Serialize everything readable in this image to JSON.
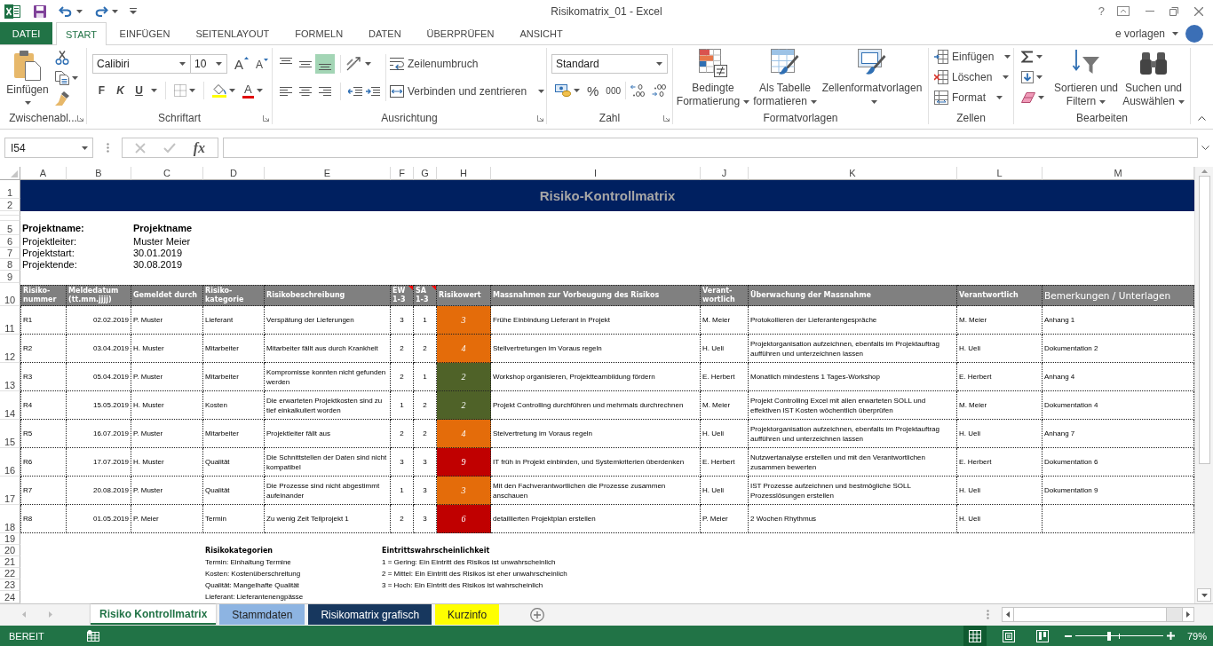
{
  "window": {
    "title": "Risikomatrix_01 - Excel",
    "help": "?"
  },
  "ribbon_tabs": [
    {
      "label": "DATEI",
      "kind": "file",
      "selected": false
    },
    {
      "label": "START",
      "kind": "tab",
      "selected": true
    },
    {
      "label": "EINFÜGEN",
      "kind": "tab",
      "selected": false
    },
    {
      "label": "SEITENLAYOUT",
      "kind": "tab",
      "selected": false
    },
    {
      "label": "FORMELN",
      "kind": "tab",
      "selected": false
    },
    {
      "label": "DATEN",
      "kind": "tab",
      "selected": false
    },
    {
      "label": "ÜBERPRÜFEN",
      "kind": "tab",
      "selected": false
    },
    {
      "label": "ANSICHT",
      "kind": "tab",
      "selected": false
    }
  ],
  "account": {
    "name": "e vorlagen"
  },
  "ribbon": {
    "clipboard": {
      "label": "Zwischenabl...",
      "paste": "Einfügen"
    },
    "font": {
      "label": "Schriftart",
      "font_name": "Calibiri",
      "font_size": "10",
      "grow": "A",
      "shrink": "A",
      "styles": [
        {
          "label": "F",
          "kind": "bold"
        },
        {
          "label": "K",
          "kind": "italic"
        },
        {
          "label": "U",
          "kind": "underline"
        }
      ],
      "font_color": "A"
    },
    "alignment": {
      "label": "Ausrichtung",
      "vertical": [
        {
          "kind": "top",
          "selected": false
        },
        {
          "kind": "middle",
          "selected": false
        },
        {
          "kind": "bottom",
          "selected": true
        }
      ],
      "wrap": "Zeilenumbruch",
      "merge": "Verbinden und zentrieren"
    },
    "number": {
      "label": "Zahl",
      "format": "Standard",
      "percent": "%",
      "thousands": "000"
    },
    "styles": {
      "label": "Formatvorlagen",
      "buttons": [
        {
          "label": "Bedingte Formatierung",
          "kind": "conditional"
        },
        {
          "label": "Als Tabelle formatieren",
          "kind": "table"
        },
        {
          "label": "Zellenformatvorlagen",
          "kind": "cell_styles"
        }
      ]
    },
    "cells": {
      "label": "Zellen",
      "buttons": [
        {
          "label": "Einfügen",
          "kind": "insert"
        },
        {
          "label": "Löschen",
          "kind": "delete"
        },
        {
          "label": "Format",
          "kind": "format"
        }
      ]
    },
    "editing": {
      "label": "Bearbeiten",
      "buttons": [
        {
          "label": "Sortieren und Filtern",
          "kind": "sort"
        },
        {
          "label": "Suchen und Auswählen",
          "kind": "find"
        }
      ]
    }
  },
  "formula_bar": {
    "name_box": "I54",
    "function_label": "fx"
  },
  "sheet": {
    "column_headers": [
      "A",
      "B",
      "C",
      "D",
      "E",
      "F",
      "G",
      "H",
      "I",
      "J",
      "K",
      "L",
      "M"
    ],
    "row_numbers": [
      "1",
      "2",
      "5",
      "6",
      "7",
      "8",
      "9",
      "10",
      "11",
      "12",
      "13",
      "14",
      "15",
      "16",
      "17",
      "18",
      "19",
      "20",
      "21",
      "22",
      "23",
      "24"
    ],
    "title": "Risiko-Kontrollmatrix",
    "project": [
      {
        "label": "Projektname:",
        "value": "Projektname",
        "bold": true
      },
      {
        "label": "Projektleiter:",
        "value": "Muster Meier",
        "bold": false
      },
      {
        "label": "Projektstart:",
        "value": "30.01.2019",
        "bold": false
      },
      {
        "label": "Projektende:",
        "value": "30.08.2019",
        "bold": false
      }
    ],
    "table": {
      "columns": [
        {
          "label": "Risiko-nummer",
          "comment": false
        },
        {
          "label": "Meldedatum (tt.mm.jjjj)",
          "comment": false
        },
        {
          "label": "Gemeldet durch",
          "comment": false
        },
        {
          "label": "Risiko-kategorie",
          "comment": false
        },
        {
          "label": "Risikobeschreibung",
          "comment": false
        },
        {
          "label": "EW 1-3",
          "comment": true
        },
        {
          "label": "SA 1-3",
          "comment": true
        },
        {
          "label": "Risikowert",
          "comment": false
        },
        {
          "label": "Massnahmen zur Vorbeugung des Risikos",
          "comment": false
        },
        {
          "label": "Verant-wortlich",
          "comment": false
        },
        {
          "label": "Überwachung der Massnahme",
          "comment": false
        },
        {
          "label": "Verantwortlich",
          "comment": false
        },
        {
          "label": "Bemerkungen / Unterlagen",
          "comment": false
        }
      ],
      "rows": [
        {
          "id": "R1",
          "date": "02.02.2019",
          "reported_by": "P. Muster",
          "category": "Lieferant",
          "description": "Verspätung der Lieferungen",
          "ew": "3",
          "sa": "1",
          "risk_value": "3",
          "color": "#e46c0a",
          "measure": "Frühe Einbindung Lieferant in Projekt",
          "responsible": "M. Meier",
          "monitoring": "Protokollieren der Lieferantengespräche",
          "monitoring_responsible": "M. Meier",
          "notes": "Anhang 1"
        },
        {
          "id": "R2",
          "date": "03.04.2019",
          "reported_by": "H. Muster",
          "category": "Mitarbeiter",
          "description": "Mitarbeiter fällt aus durch Krankheit",
          "ew": "2",
          "sa": "2",
          "risk_value": "4",
          "color": "#e46c0a",
          "measure": "Stellvertretungen im Voraus regeln",
          "responsible": "H. Ueli",
          "monitoring": "Projektorganisation aufzeichnen, ebenfalls im Projektauftrag aufführen und unterzeichnen lassen",
          "monitoring_responsible": "H. Ueli",
          "notes": "Dokumentation 2"
        },
        {
          "id": "R3",
          "date": "05.04.2019",
          "reported_by": "P. Muster",
          "category": "Mitarbeiter",
          "description": "Kompromisse konnten nicht gefunden werden",
          "ew": "2",
          "sa": "1",
          "risk_value": "2",
          "color": "#4f6228",
          "measure": "Workshop organisieren, Projektteambildung fördern",
          "responsible": "E. Herbert",
          "monitoring": "Monatlich mindestens 1 Tages-Workshop",
          "monitoring_responsible": "E. Herbert",
          "notes": "Anhang 4"
        },
        {
          "id": "R4",
          "date": "15.05.2019",
          "reported_by": "H. Muster",
          "category": "Kosten",
          "description": "Die erwarteten Projektkosten sind zu tief einkalkuliert worden",
          "ew": "1",
          "sa": "2",
          "risk_value": "2",
          "color": "#4f6228",
          "measure": "Projekt Controlling durchführen und mehrmals durchrechnen",
          "responsible": "M. Meier",
          "monitoring": "Projekt Controlling Excel mit allen erwarteten SOLL und effektiven IST Kosten wöchentlich überprüfen",
          "monitoring_responsible": "M. Meier",
          "notes": "Dokumentation 4"
        },
        {
          "id": "R5",
          "date": "16.07.2019",
          "reported_by": "P. Muster",
          "category": "Mitarbeiter",
          "description": "Projektleiter fällt aus",
          "ew": "2",
          "sa": "2",
          "risk_value": "4",
          "color": "#e46c0a",
          "measure": "Stelvertretung im Voraus regeln",
          "responsible": "H. Ueli",
          "monitoring": "Projektorganisation aufzeichnen, ebenfalls im Projektauftrag aufführen und unterzeichnen lassen",
          "monitoring_responsible": "H. Ueli",
          "notes": "Anhang 7"
        },
        {
          "id": "R6",
          "date": "17.07.2019",
          "reported_by": "H. Muster",
          "category": "Qualität",
          "description": "Die Schnittstellen der Daten sind nicht kompatibel",
          "ew": "3",
          "sa": "3",
          "risk_value": "9",
          "color": "#c00000",
          "measure": "IT früh in Projekt einbinden, und Systemkriterien überdenken",
          "responsible": "E. Herbert",
          "monitoring": "Nutzwertanalyse erstellen und mit den Verantwortlichen zusammen bewerten",
          "monitoring_responsible": "E. Herbert",
          "notes": "Dokumentation 6"
        },
        {
          "id": "R7",
          "date": "20.08.2019",
          "reported_by": "P. Muster",
          "category": "Qualität",
          "description": "Die Prozesse sind nicht abgestimmt aufeinander",
          "ew": "1",
          "sa": "3",
          "risk_value": "3",
          "color": "#e46c0a",
          "measure": "Mit den Fachverantwortlichen die Prozesse zusammen anschauen",
          "responsible": "H. Ueli",
          "monitoring": "IST Prozesse aufzeichnen und bestmögliche SOLL Prozesslösungen erstellen",
          "monitoring_responsible": "H. Ueli",
          "notes": "Dokumentation 9"
        },
        {
          "id": "R8",
          "date": "01.05.2019",
          "reported_by": "P. Meier",
          "category": "Termin",
          "description": "Zu wenig Zeit Teilprojekt 1",
          "ew": "2",
          "sa": "3",
          "risk_value": "6",
          "color": "#c00000",
          "measure": "detaillierten Projektplan erstellen",
          "responsible": "P. Meier",
          "monitoring": "2 Wochen Rhythmus",
          "monitoring_responsible": "H. Ueli"
        }
      ]
    },
    "legend": [
      {
        "title": "Risikokategorien",
        "items": [
          "Termin: Einhaltung Termine",
          "Kosten: Kostenüberschreitung",
          "Qualität: Mangelhafte Qualität",
          "Lieferant: Lieferantenengpässe"
        ]
      },
      {
        "title": "Eintrittswahrscheinlichkeit",
        "items": [
          "1 = Gering: Ein Eintritt des Risikos ist unwahrscheinlich",
          "2 = Mittel: Ein Eintritt des Risikos ist eher unwahrscheinlich",
          "3 = Hoch: Ein Eintritt des Risikos ist wahrscheinlich"
        ]
      }
    ]
  },
  "sheet_tabs": [
    {
      "label": "Risiko Kontrollmatrix",
      "selected": true
    },
    {
      "label": "Stammdaten",
      "selected": false,
      "color": "#8db4e2"
    },
    {
      "label": "Risikomatrix grafisch",
      "selected": false,
      "color": "#17375e"
    },
    {
      "label": "Kurzinfo",
      "selected": false,
      "color": "#ffff00"
    }
  ],
  "status_bar": {
    "status": "BEREIT",
    "views": [
      {
        "kind": "normal",
        "selected": true
      },
      {
        "kind": "page_layout",
        "selected": false
      },
      {
        "kind": "page_break",
        "selected": false
      }
    ],
    "zoom": {
      "level": 0.38,
      "reading": "79%"
    }
  }
}
